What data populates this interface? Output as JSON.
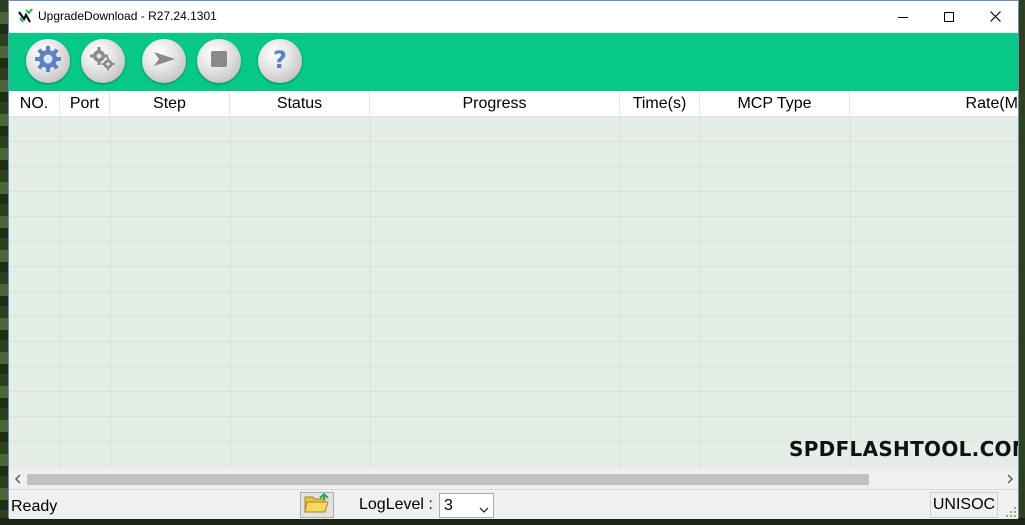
{
  "window": {
    "title": "UpgradeDownload - R27.24.1301",
    "controls": [
      "minimize-icon",
      "maximize-icon",
      "close-icon"
    ]
  },
  "toolbar": {
    "buttons": [
      {
        "name": "load-packet-button",
        "icon": "gear-icon"
      },
      {
        "name": "settings-button",
        "icon": "gears-icon"
      },
      {
        "name": "start-download-button",
        "icon": "play-arrow-icon"
      },
      {
        "name": "stop-download-button",
        "icon": "stop-icon"
      },
      {
        "name": "help-button",
        "icon": "help-icon"
      }
    ],
    "background": "#07c886"
  },
  "grid": {
    "columns": [
      "NO.",
      "Port",
      "Step",
      "Status",
      "Progress",
      "Time(s)",
      "MCP Type",
      "Rate(M"
    ],
    "rows": [],
    "background": "#e4ede6",
    "watermark": "SPDFLASHTOOL.COM"
  },
  "statusbar": {
    "status": "Ready",
    "log_level_label": "LogLevel :",
    "log_level_value": "3",
    "vendor": "UNISOC"
  }
}
